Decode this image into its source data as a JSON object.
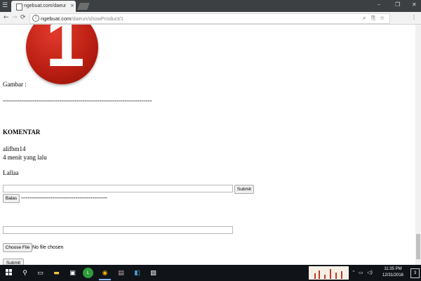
{
  "browser": {
    "tab_title": "ngebuat.com/daeun/sh",
    "tab_close": "×",
    "url_host": "ngebuat.com",
    "url_path": "/daeun/showProduct/1",
    "window_controls": {
      "minimize": "–",
      "maximize": "❐",
      "close": "✕"
    },
    "nav": {
      "back": "←",
      "forward": "→",
      "reload": "⟳"
    }
  },
  "product": {
    "badge_number": "1",
    "image_label": "Gambar :",
    "divider": "-----------------------------------------------------------------------"
  },
  "comments": {
    "heading": "KOMENTAR",
    "items": [
      {
        "author": "alifbm14",
        "time": "4 menit yang lalu",
        "text": "Lallaa"
      }
    ],
    "reply_submit_label": "Submit",
    "reply_button_label": "Balas",
    "reply_divider": "-----------------------------------------",
    "choose_file_label": "Choose File",
    "no_file_text": "No file chosen",
    "submit_label": "Submit"
  },
  "taskbar": {
    "clock_time": "11:35 PM",
    "clock_date": "12/31/2016",
    "notification_count": "3"
  },
  "colors": {
    "badge": "#c0251a",
    "taskbar": "#101418",
    "tabstrip": "#3c4043"
  }
}
